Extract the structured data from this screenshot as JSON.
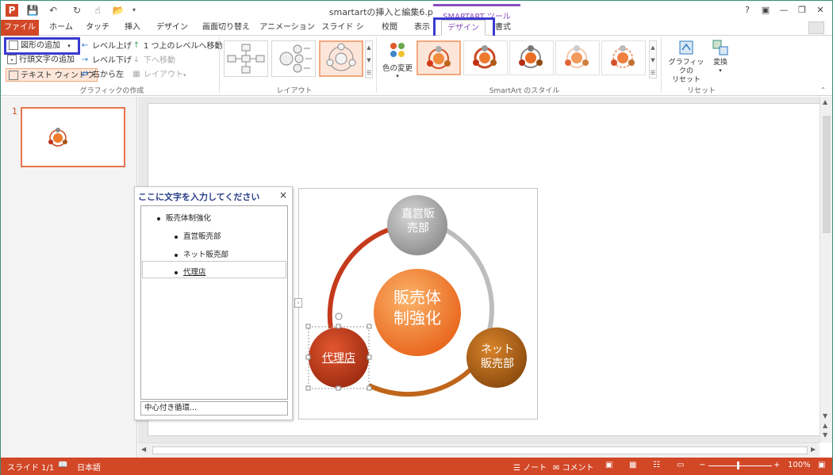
{
  "window": {
    "title": "smartartの挿入と編集6.pptx - PowerPoint",
    "context_tools": "SMARTART ツール",
    "help": "?",
    "user_initial": ""
  },
  "tabs": [
    "ファイル",
    "ホーム",
    "タッチ",
    "挿入",
    "デザイン",
    "画面切り替え",
    "アニメーション",
    "スライド ショー",
    "校閲",
    "表示",
    "デザイン",
    "書式"
  ],
  "ribbon": {
    "create_graphic": {
      "add_shape": "図形の追加",
      "add_bullet": "行頭文字の追加",
      "text_pane": "テキスト ウィンドウ",
      "promote": "レベル上げ",
      "demote": "レベル下げ",
      "right_to_left": "右から左",
      "move_up": "1 つ上のレベルへ移動",
      "move_down": "下へ移動",
      "layout": "レイアウト",
      "label": "グラフィックの作成"
    },
    "layouts": {
      "label": "レイアウト"
    },
    "styles": {
      "change_colors": "色の変更",
      "label": "SmartArt のスタイル"
    },
    "reset": {
      "reset_graphic_1": "グラフィックの",
      "reset_graphic_2": "リセット",
      "convert": "変換",
      "label": "リセット"
    }
  },
  "slides_pane": {
    "number": "1"
  },
  "text_pane": {
    "title": "ここに文字を入力してください",
    "close": "×",
    "items": [
      {
        "level": 1,
        "text": "販売体制強化"
      },
      {
        "level": 2,
        "text": "直営販売部"
      },
      {
        "level": 2,
        "text": "ネット販売部"
      },
      {
        "level": 2,
        "text": "代理店"
      }
    ],
    "footer": "中心付き循環..."
  },
  "smartart": {
    "center_1": "販売体",
    "center_2": "制強化",
    "top_1": "直営販",
    "top_2": "売部",
    "right_1": "ネット",
    "right_2": "販売部",
    "left": "代理店"
  },
  "status": {
    "slide": "スライド 1/1",
    "language": "日本語",
    "notes": "ノート",
    "comments": "コメント",
    "zoom": "100%"
  },
  "colors": {
    "accent": "#d24726",
    "context": "#8a4fc0",
    "highlight": "#3a3ad0"
  }
}
